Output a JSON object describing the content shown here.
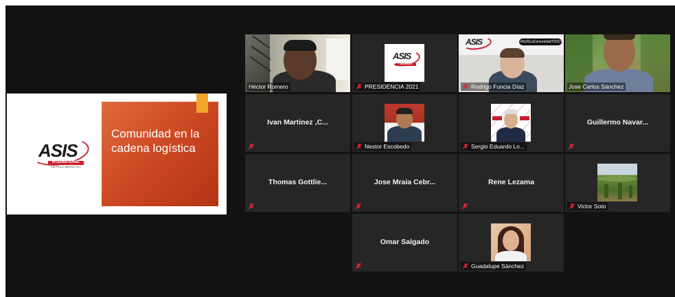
{
  "shared_slide": {
    "title": "Comunidad en la cadena logística",
    "logo": {
      "word": "ASIS",
      "band": "INTERNATIONAL",
      "sub": "CAPÍTULO MÉXICO 217"
    }
  },
  "tile_logo": {
    "word": "ASIS",
    "band": "SEGURIDAD"
  },
  "banner_hashtag": "#ASISLaComunidadTODO",
  "participants": [
    {
      "name": "Héctor Romero",
      "type": "video",
      "muted": false,
      "active": true
    },
    {
      "name": "PRESIDENCIA 2021",
      "type": "logo",
      "muted": true
    },
    {
      "name": "Rodrigo Funcia Díaz",
      "type": "video",
      "muted": true
    },
    {
      "name": "Jose Carlos Sánchez",
      "type": "video",
      "muted": false
    },
    {
      "name": "Ivan Martinez ,C...",
      "type": "name",
      "muted": true
    },
    {
      "name": "Nestor Escobedo",
      "type": "photo",
      "muted": true
    },
    {
      "name": "Sergio Eduardo Lo...",
      "type": "photo",
      "muted": true
    },
    {
      "name": "Guillermo Navar...",
      "type": "name",
      "muted": true
    },
    {
      "name": "Thomas Gottlie...",
      "type": "name",
      "muted": true
    },
    {
      "name": "Jose Mraia Cebr...",
      "type": "name",
      "muted": true
    },
    {
      "name": "Rene Lezama",
      "type": "name",
      "muted": true
    },
    {
      "name": "Victor Soto",
      "type": "photo",
      "muted": true
    },
    {
      "name": "Omar Salgado",
      "type": "name",
      "muted": true
    },
    {
      "name": "Guadalupe Sánchez",
      "type": "photo",
      "muted": true
    }
  ],
  "colors": {
    "background": "#121212",
    "tile": "#262626",
    "active_border": "#9ccf2a",
    "muted_icon": "#e0263a",
    "slide_orange": "#c9451f",
    "slide_accent": "#f2a62c",
    "brand_red": "#c8202f"
  }
}
